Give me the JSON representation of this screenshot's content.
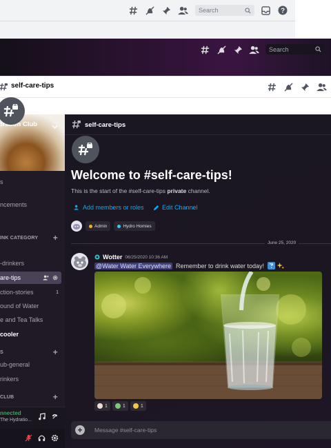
{
  "top_toolbar": {
    "search_placeholder": "Search",
    "icons": [
      "threads-icon",
      "mute-icon",
      "pin-icon",
      "members-icon",
      "search-icon",
      "inbox-icon",
      "help-icon"
    ]
  },
  "dark_toolbar": {
    "search_placeholder": "Search",
    "icons": [
      "threads-icon",
      "mute-icon",
      "pin-icon",
      "members-icon",
      "search-icon"
    ]
  },
  "light_header": {
    "channel_name": "self-care-tips"
  },
  "sidebar": {
    "server_name": "dration Club",
    "items": [
      {
        "label": "s",
        "kind": "channel"
      },
      {
        "label": "ncements",
        "kind": "channel"
      },
      {
        "label": "INK CATEGORY",
        "kind": "category"
      },
      {
        "label": "-drinkers",
        "kind": "channel"
      },
      {
        "label": "are-tips",
        "kind": "channel-selected"
      },
      {
        "label": "ction-stories",
        "kind": "channel",
        "badge": "1"
      },
      {
        "label": "ound of Water",
        "kind": "channel"
      },
      {
        "label": "e and Tea Talks",
        "kind": "channel"
      },
      {
        "label": "cooler",
        "kind": "channel-bright"
      },
      {
        "label": "S",
        "kind": "category"
      },
      {
        "label": "ub-general",
        "kind": "channel"
      },
      {
        "label": "rinkers",
        "kind": "channel"
      },
      {
        "label": "CLUB",
        "kind": "category"
      }
    ],
    "voice": {
      "status": "nnected",
      "channel": "The Hydratio..."
    }
  },
  "main": {
    "channel_name": "self-care-tips",
    "welcome_title": "Welcome to #self-care-tips!",
    "welcome_sub_prefix": "This is the start of the #self-care-tips ",
    "welcome_sub_bold": "private",
    "welcome_sub_suffix": " channel.",
    "add_members_label": "Add members or roles",
    "edit_channel_label": "Edit Channel",
    "roles": [
      {
        "name": "Admin",
        "color": "#f0b232"
      },
      {
        "name": "Hydro Homies",
        "color": "#3ec6f0"
      }
    ],
    "date_divider": "June 25, 2020",
    "message": {
      "author": "Wotter",
      "timestamp": "06/25/2020 10:36 AM",
      "mention": "@Water Water Everywhere",
      "text": "Remember to drink water today!"
    },
    "reactions": [
      {
        "count": "1",
        "color": "#e8e0d6"
      },
      {
        "count": "1",
        "color": "#7fc77a"
      },
      {
        "count": "1",
        "color": "#f0c74a"
      }
    ],
    "composer_placeholder": "Message #self-care-tips"
  }
}
